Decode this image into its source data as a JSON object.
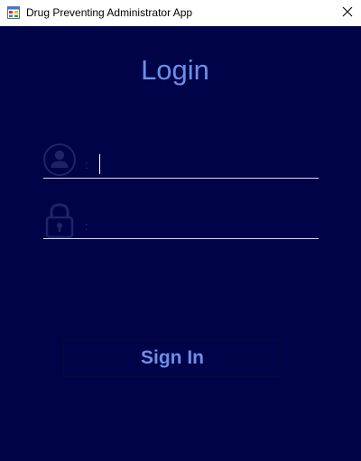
{
  "window": {
    "title": "Drug Preventing Administrator App",
    "icon": "app-form-icon",
    "close_icon": "close-icon"
  },
  "login": {
    "heading": "Login",
    "username": {
      "icon": "user-icon",
      "separator": ":",
      "value": "",
      "placeholder": ""
    },
    "password": {
      "icon": "lock-icon",
      "separator": ":",
      "value": "",
      "placeholder": ""
    },
    "sign_in_label": "Sign In"
  },
  "colors": {
    "background": "#000347",
    "accent": "#6b8fe8",
    "icon_muted": "#1e2466",
    "underline": "#d8d8e6"
  }
}
